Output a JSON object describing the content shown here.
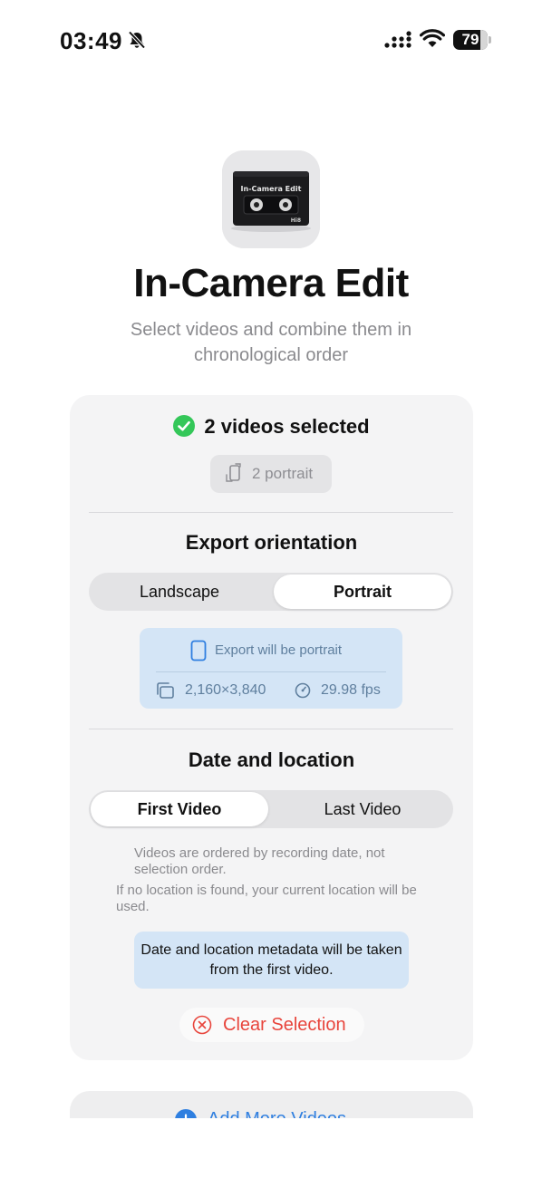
{
  "status_bar": {
    "time": "03:49",
    "battery": "79",
    "icons": [
      "bell-slash-icon",
      "signal-icon",
      "wifi-icon",
      "battery-icon"
    ]
  },
  "header": {
    "app_icon": "cassette-tape-icon",
    "title": "In-Camera Edit",
    "subtitle": "Select videos and combine them in chronological order"
  },
  "selection": {
    "icon": "checkmark-circle-icon",
    "summary": "2 videos selected",
    "chip_icon": "rotate-device-icon",
    "chip_label": "2 portrait"
  },
  "export_orientation": {
    "title": "Export orientation",
    "options": [
      "Landscape",
      "Portrait"
    ],
    "selected": "Portrait",
    "info_icon": "portrait-phone-icon",
    "info_label": "Export will be portrait",
    "resolution_icon": "stacked-frames-icon",
    "resolution": "2,160×3,840",
    "fps_icon": "gauge-icon",
    "fps": "29.98 fps"
  },
  "date_location": {
    "title": "Date and location",
    "options": [
      "First Video",
      "Last Video"
    ],
    "selected": "First Video",
    "note_order": "Videos are ordered by recording date, not selection order.",
    "note_location": "If no location is found, your current location will be used.",
    "metadata_info": "Date and location metadata will be taken from the first video."
  },
  "actions": {
    "clear_icon": "x-circle-icon",
    "clear_label": "Clear Selection",
    "add_icon": "plus-circle-icon",
    "add_label": "Add More Videos"
  },
  "colors": {
    "accent_blue": "#2f7fe0",
    "success_green": "#34c759",
    "destructive_red": "#e8453c",
    "info_background": "#d4e5f6",
    "card_background": "#f4f4f5"
  }
}
